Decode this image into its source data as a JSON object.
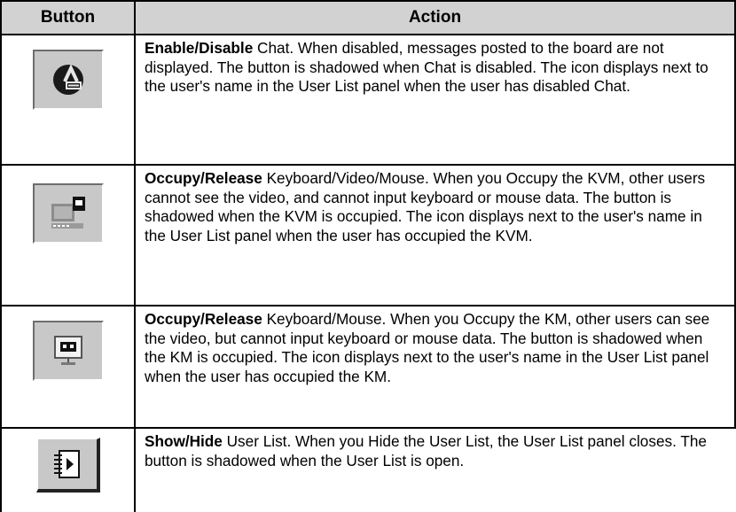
{
  "table": {
    "headers": {
      "button": "Button",
      "action": "Action"
    },
    "rows": [
      {
        "icon": "chat-toggle-icon",
        "title": "Enable/Disable",
        "text": " Chat. When disabled, messages posted to the board are not displayed. The button is shadowed when Chat is disabled. The icon displays next to the user's name in the User List panel when the user has disabled Chat."
      },
      {
        "icon": "occupy-kvm-icon",
        "title": "Occupy/Release",
        "text": " Keyboard/Video/Mouse. When you Occupy the KVM, other users cannot see the video, and cannot input keyboard or mouse data. The button is shadowed when the KVM is occupied. The icon displays next to the user's name in the User List panel when the user has occupied the KVM."
      },
      {
        "icon": "occupy-km-icon",
        "title": "Occupy/Release",
        "text": " Keyboard/Mouse. When you Occupy the KM, other users can see the video, but cannot input keyboard or mouse data. The button is shadowed when the KM is occupied. The icon displays next to the user's name in the User List panel when the user has occupied the KM."
      },
      {
        "icon": "user-list-icon",
        "title": "Show/Hide",
        "text": " User List. When you Hide the User List, the User List panel closes. The button is shadowed when the User List is open."
      }
    ]
  }
}
